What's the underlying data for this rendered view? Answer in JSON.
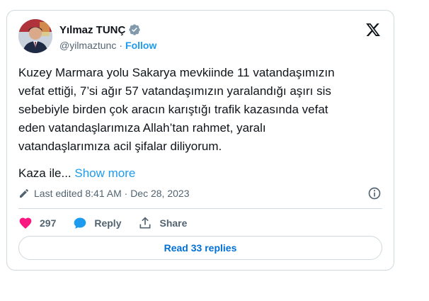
{
  "author": {
    "name": "Yılmaz TUNÇ",
    "handle": "@yilmaztunc",
    "separator": "·",
    "follow_label": "Follow"
  },
  "tweet": {
    "text": "Kuzey Marmara yolu Sakarya mevkiinde 11 vatandaşımızın\nvefat ettiği, 7’si ağır 57 vatandaşımızın yaralandığı aşırı sis\nsebebiyle birden çok aracın karıştığı trafik kazasında vefat\neden vatandaşlarımıza Allah’tan rahmet, yaralı\nvatandaşlarımıza acil şifalar diliyorum.",
    "truncated_text": "Kaza ile...",
    "show_more_label": "Show more",
    "edited_label": "Last edited 8:41 AM · Dec 28, 2023"
  },
  "actions": {
    "like_count": "297",
    "reply_label": "Reply",
    "share_label": "Share"
  },
  "read_replies_label": "Read 33 replies",
  "colors": {
    "accent": "#1d9bf0",
    "like": "#f91880",
    "text": "#0f1419",
    "muted": "#536471",
    "border": "#cfd9de"
  },
  "icons": [
    "verified-badge-icon",
    "x-logo-icon",
    "edit-pencil-icon",
    "info-icon",
    "heart-icon",
    "reply-bubble-icon",
    "share-icon"
  ]
}
